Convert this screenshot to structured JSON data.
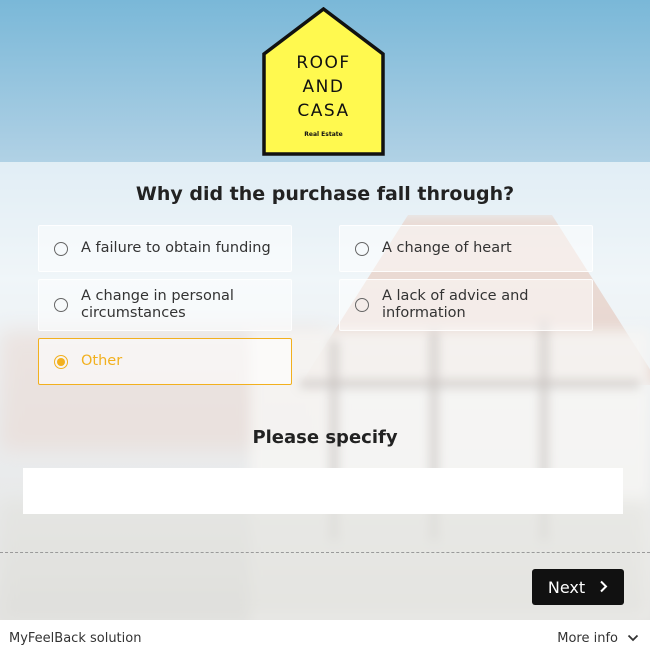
{
  "logo": {
    "lines": [
      "ROOF",
      "AND",
      "CASA"
    ],
    "tagline": "Real Estate",
    "color": "#fff94f"
  },
  "question": "Why did the purchase fall through?",
  "options": [
    {
      "label": "A failure to obtain funding",
      "selected": false
    },
    {
      "label": "A change of heart",
      "selected": false
    },
    {
      "label": "A change in personal circumstances",
      "selected": false
    },
    {
      "label": "A lack of advice and information",
      "selected": false
    },
    {
      "label": "Other",
      "selected": true
    }
  ],
  "specify": {
    "label": "Please specify",
    "value": "",
    "placeholder": ""
  },
  "next_label": "Next",
  "footer": {
    "brand": "MyFeelBack solution",
    "more_info": "More info"
  },
  "colors": {
    "accent": "#f2b01e",
    "button": "#111111"
  }
}
